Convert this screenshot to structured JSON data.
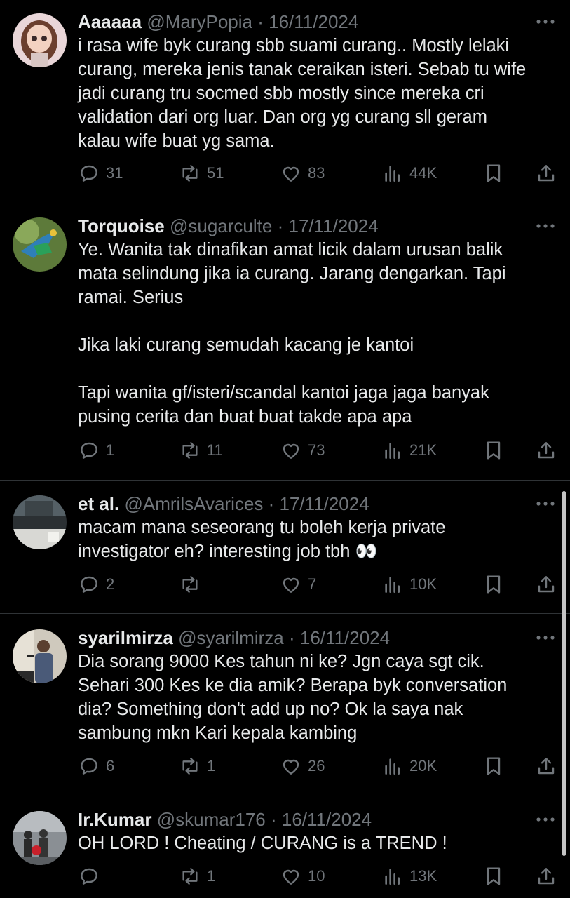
{
  "tweets": [
    {
      "name": "Aaaaaa",
      "handle": "@MaryPopia",
      "sep": "·",
      "date": "16/11/2024",
      "text": "i rasa wife byk curang sbb suami curang.. Mostly lelaki\ncurang, mereka jenis tanak ceraikan isteri. Sebab tu wife\njadi curang tru socmed sbb mostly since mereka cri\nvalidation dari org luar. Dan org yg curang sll geram\nkalau wife buat yg sama.",
      "replies": "31",
      "reposts": "51",
      "likes": "83",
      "views": "44K",
      "avatar_icon": "cartoon-girl-avatar"
    },
    {
      "name": "Torquoise",
      "handle": "@sugarculte",
      "sep": "·",
      "date": "17/11/2024",
      "text": "Ye. Wanita tak dinafikan amat licik dalam urusan balik\nmata selindung jika ia curang. Jarang dengarkan. Tapi\nramai. Serius\n\nJika laki curang semudah kacang je kantoi\n\nTapi wanita gf/isteri/scandal kantoi jaga jaga banyak\npusing cerita dan buat buat takde apa apa",
      "replies": "1",
      "reposts": "11",
      "likes": "73",
      "views": "21K",
      "avatar_icon": "bird-avatar"
    },
    {
      "name": "et al.",
      "handle": "@AmrilsAvarices",
      "sep": "·",
      "date": "17/11/2024",
      "text": "macam mana seseorang tu boleh kerja private\ninvestigator eh? interesting job tbh 👀",
      "replies": "2",
      "reposts": "",
      "likes": "7",
      "views": "10K",
      "avatar_icon": "window-photo-avatar"
    },
    {
      "name": "syarilmirza",
      "handle": "@syarilmirza",
      "sep": "·",
      "date": "16/11/2024",
      "text": "Dia sorang 9000 Kes tahun ni ke? Jgn caya sgt cik.\nSehari 300 Kes ke dia amik? Berapa byk conversation\ndia? Something don't add up no? Ok la saya nak\nsambung mkn Kari kepala kambing",
      "replies": "6",
      "reposts": "1",
      "likes": "26",
      "views": "20K",
      "avatar_icon": "speaker-avatar"
    },
    {
      "name": "Ir.Kumar",
      "handle": "@skumar176",
      "sep": "·",
      "date": "16/11/2024",
      "text": "OH LORD ! Cheating / CURANG is a TREND !",
      "replies": "",
      "reposts": "1",
      "likes": "10",
      "views": "13K",
      "avatar_icon": "street-photo-avatar"
    }
  ],
  "colors": {
    "background": "#000000",
    "text": "#e7e9ea",
    "secondary": "#71767b",
    "divider": "#2f3336"
  }
}
